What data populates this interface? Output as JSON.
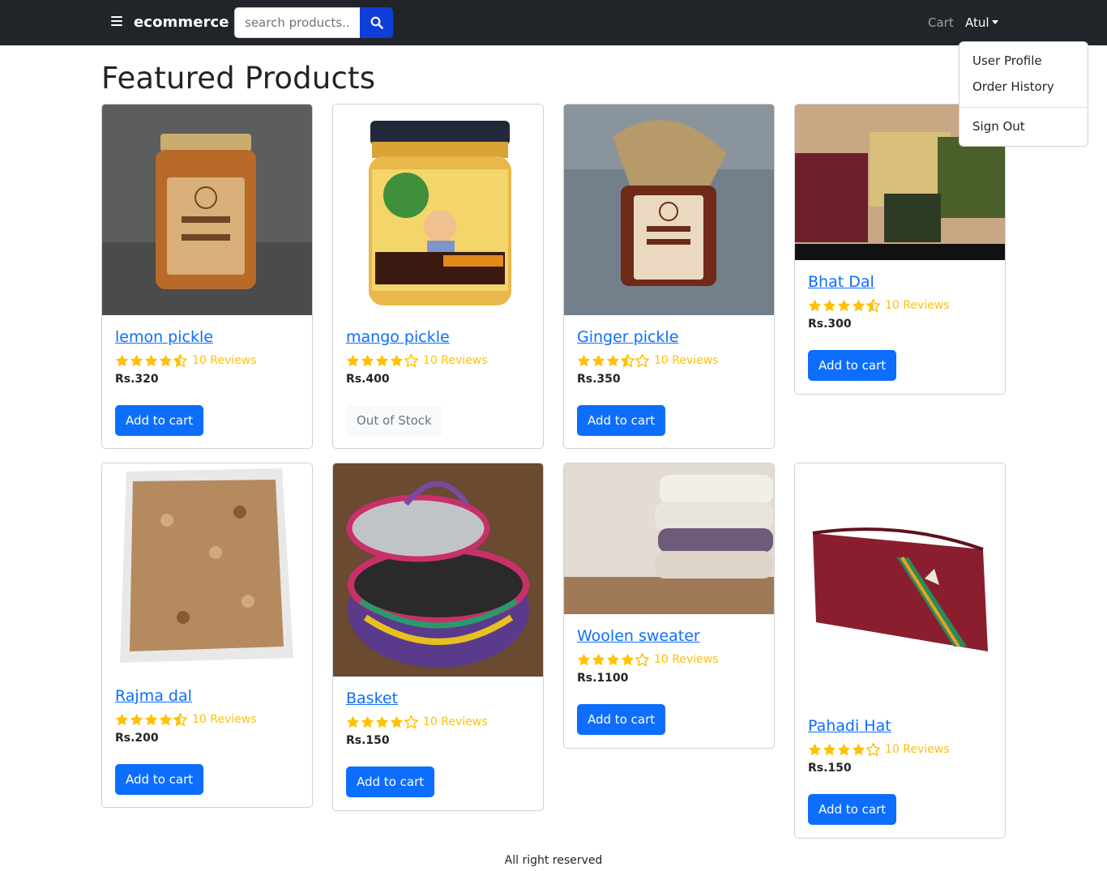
{
  "navbar": {
    "brand": "ecommerce",
    "search_placeholder": "search products....",
    "cart_label": "Cart",
    "user_label": "Atul"
  },
  "dropdown": {
    "items": [
      "User Profile",
      "Order History",
      "Sign Out"
    ]
  },
  "page_title": "Featured Products",
  "colors": {
    "navbar_bg": "#212529",
    "primary": "#0d6efd",
    "search_button": "#0d3ed8",
    "star": "#ffc107"
  },
  "products": [
    {
      "name": "lemon pickle",
      "rating": 4.5,
      "reviews": "10 Reviews",
      "price": "Rs.320",
      "action": "Add to cart",
      "in_stock": true
    },
    {
      "name": "mango pickle",
      "rating": 4,
      "reviews": "10 Reviews",
      "price": "Rs.400",
      "action": "Out of Stock",
      "in_stock": false
    },
    {
      "name": "Ginger pickle",
      "rating": 3.5,
      "reviews": "10 Reviews",
      "price": "Rs.350",
      "action": "Add to cart",
      "in_stock": true
    },
    {
      "name": "Bhat Dal",
      "rating": 4.5,
      "reviews": "10 Reviews",
      "price": "Rs.300",
      "action": "Add to cart",
      "in_stock": true
    },
    {
      "name": "Rajma dal",
      "rating": 4.5,
      "reviews": "10 Reviews",
      "price": "Rs.200",
      "action": "Add to cart",
      "in_stock": true
    },
    {
      "name": "Basket",
      "rating": 4,
      "reviews": "10 Reviews",
      "price": "Rs.150",
      "action": "Add to cart",
      "in_stock": true
    },
    {
      "name": "Woolen sweater",
      "rating": 4,
      "reviews": "10 Reviews",
      "price": "Rs.1100",
      "action": "Add to cart",
      "in_stock": true
    },
    {
      "name": "Pahadi Hat",
      "rating": 4,
      "reviews": "10 Reviews",
      "price": "Rs.150",
      "action": "Add to cart",
      "in_stock": true
    }
  ],
  "footer": "All right reserved"
}
